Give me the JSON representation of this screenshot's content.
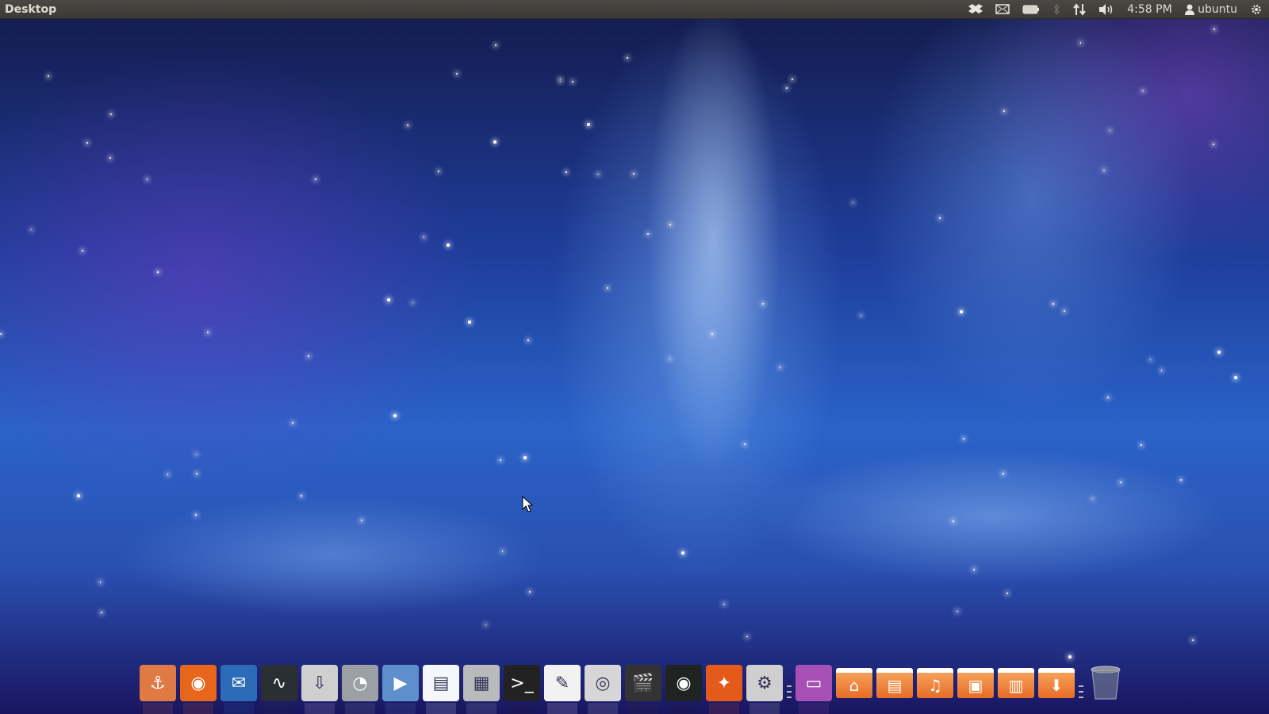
{
  "topbar": {
    "title": "Desktop",
    "time": "4:58 PM",
    "user": "ubuntu"
  },
  "indicators": [
    "dropbox-icon",
    "mail-icon",
    "battery-icon",
    "bluetooth-icon",
    "network-icon",
    "volume-icon",
    "user-icon",
    "session-gear-icon"
  ],
  "dock": {
    "items": [
      {
        "name": "anchor",
        "color": "#e07a45",
        "glyph": "⚓"
      },
      {
        "name": "firefox",
        "color": "#e8661c",
        "glyph": "◉"
      },
      {
        "name": "thunderbird",
        "color": "#2b6bb8",
        "glyph": "✉"
      },
      {
        "name": "system-monitor",
        "color": "#2a2f33",
        "glyph": "∿"
      },
      {
        "name": "install",
        "color": "#cfcfcf",
        "glyph": "⇩"
      },
      {
        "name": "disk-usage",
        "color": "#9aa0a3",
        "glyph": "◔"
      },
      {
        "name": "media-player",
        "color": "#5d8fcc",
        "glyph": "▶"
      },
      {
        "name": "writer-document",
        "color": "#f4f8fc",
        "glyph": "▤"
      },
      {
        "name": "calculator",
        "color": "#b8babc",
        "glyph": "▦"
      },
      {
        "name": "terminal",
        "color": "#222",
        "glyph": ">_"
      },
      {
        "name": "text-editor",
        "color": "#f2f2f2",
        "glyph": "✎"
      },
      {
        "name": "camera",
        "color": "#d6d6d6",
        "glyph": "◎"
      },
      {
        "name": "video-editor",
        "color": "#333",
        "glyph": "🎬"
      },
      {
        "name": "safe",
        "color": "#1f2322",
        "glyph": "◉"
      },
      {
        "name": "software-center",
        "color": "#e35a1a",
        "glyph": "✦"
      },
      {
        "name": "system-settings",
        "color": "#cfcfcf",
        "glyph": "⚙"
      },
      {
        "name": "computer",
        "color": "#a64fb5",
        "glyph": "▭"
      }
    ],
    "folders": [
      {
        "name": "home-folder",
        "glyph": "⌂"
      },
      {
        "name": "documents-folder",
        "glyph": "▤"
      },
      {
        "name": "music-folder",
        "glyph": "♫"
      },
      {
        "name": "pictures-folder",
        "glyph": "▣"
      },
      {
        "name": "videos-folder",
        "glyph": "▥"
      },
      {
        "name": "downloads-folder",
        "glyph": "⬇"
      }
    ]
  },
  "colors": {
    "topbar": "#3c3b37",
    "folder": "#e86b25"
  }
}
